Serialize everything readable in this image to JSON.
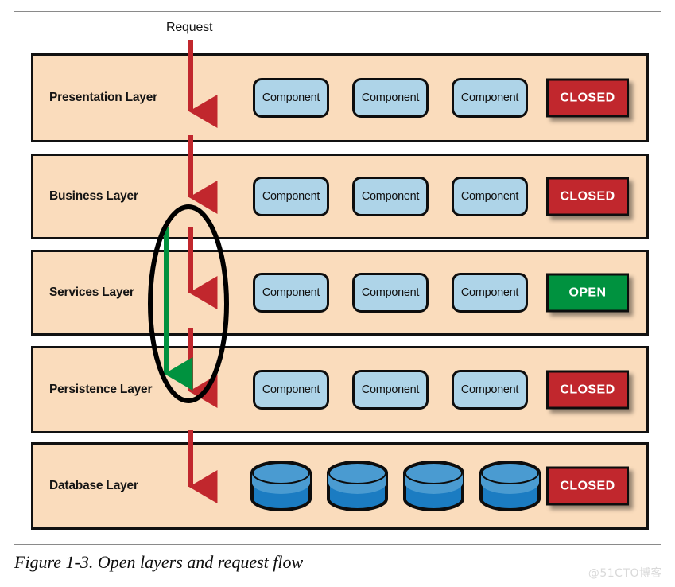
{
  "figure": {
    "caption": "Figure 1-3. Open layers and request flow",
    "watermark": "@51CTO博客"
  },
  "request": {
    "label": "Request"
  },
  "component_label": "Component",
  "colors": {
    "band_fill": "#fadcbc",
    "band_border": "#111111",
    "component_fill": "#aed4e8",
    "closed_badge": "#c1272d",
    "open_badge": "#00923f",
    "request_arrow": "#c1272d",
    "bypass_arrow": "#00923f",
    "cylinder_top": "#4a9bd1",
    "cylinder_body": "#1b7cc2",
    "frame_border": "#8a8a8a",
    "watermark_text": "#d9d9d9"
  },
  "layers": [
    {
      "name": "Presentation Layer",
      "status": "CLOSED",
      "status_state": "closed",
      "components": [
        "Component",
        "Component",
        "Component"
      ],
      "content_type": "components"
    },
    {
      "name": "Business Layer",
      "status": "CLOSED",
      "status_state": "closed",
      "components": [
        "Component",
        "Component",
        "Component"
      ],
      "content_type": "components"
    },
    {
      "name": "Services Layer",
      "status": "OPEN",
      "status_state": "open",
      "components": [
        "Component",
        "Component",
        "Component"
      ],
      "content_type": "components"
    },
    {
      "name": "Persistence Layer",
      "status": "CLOSED",
      "status_state": "closed",
      "components": [
        "Component",
        "Component",
        "Component"
      ],
      "content_type": "components"
    },
    {
      "name": "Database Layer",
      "status": "CLOSED",
      "status_state": "closed",
      "databases": [
        "database",
        "database",
        "database",
        "database"
      ],
      "content_type": "databases"
    }
  ]
}
